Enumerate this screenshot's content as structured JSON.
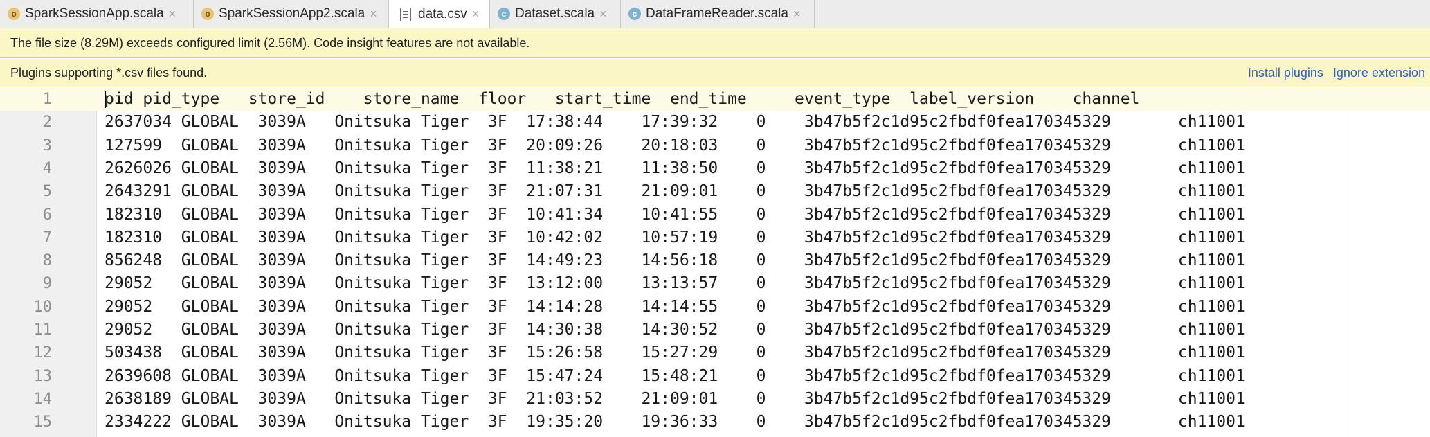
{
  "tabs": [
    {
      "label": "SparkSessionApp.scala",
      "icon": "scala-object-icon",
      "icon_glyph": "o",
      "close": "×"
    },
    {
      "label": "SparkSessionApp2.scala",
      "icon": "scala-object-icon",
      "icon_glyph": "o",
      "close": "×"
    },
    {
      "label": "data.csv",
      "icon": "csv-file-icon",
      "icon_glyph": "",
      "close": "×",
      "active": true
    },
    {
      "label": "Dataset.scala",
      "icon": "scala-class-icon",
      "icon_glyph": "c",
      "close": "×"
    },
    {
      "label": "DataFrameReader.scala",
      "icon": "scala-class-icon",
      "icon_glyph": "c",
      "close": "×"
    }
  ],
  "banners": {
    "size_warning": "The file size (8.29M) exceeds configured limit (2.56M). Code insight features are not available.",
    "plugins_text": "Plugins supporting *.csv files found.",
    "install_plugins": "Install plugins",
    "ignore_extension": "Ignore extension"
  },
  "editor": {
    "lines": [
      {
        "num": "1",
        "text": "pid pid_type   store_id    store_name  floor   start_time  end_time     event_type  label_version    channel"
      },
      {
        "num": "2",
        "text": "2637034 GLOBAL  3039A   Onitsuka Tiger  3F  17:38:44    17:39:32    0    3b47b5f2c1d95c2fbdf0fea170345329       ch11001"
      },
      {
        "num": "3",
        "text": "127599  GLOBAL  3039A   Onitsuka Tiger  3F  20:09:26    20:18:03    0    3b47b5f2c1d95c2fbdf0fea170345329       ch11001"
      },
      {
        "num": "4",
        "text": "2626026 GLOBAL  3039A   Onitsuka Tiger  3F  11:38:21    11:38:50    0    3b47b5f2c1d95c2fbdf0fea170345329       ch11001"
      },
      {
        "num": "5",
        "text": "2643291 GLOBAL  3039A   Onitsuka Tiger  3F  21:07:31    21:09:01    0    3b47b5f2c1d95c2fbdf0fea170345329       ch11001"
      },
      {
        "num": "6",
        "text": "182310  GLOBAL  3039A   Onitsuka Tiger  3F  10:41:34    10:41:55    0    3b47b5f2c1d95c2fbdf0fea170345329       ch11001"
      },
      {
        "num": "7",
        "text": "182310  GLOBAL  3039A   Onitsuka Tiger  3F  10:42:02    10:57:19    0    3b47b5f2c1d95c2fbdf0fea170345329       ch11001"
      },
      {
        "num": "8",
        "text": "856248  GLOBAL  3039A   Onitsuka Tiger  3F  14:49:23    14:56:18    0    3b47b5f2c1d95c2fbdf0fea170345329       ch11001"
      },
      {
        "num": "9",
        "text": "29052   GLOBAL  3039A   Onitsuka Tiger  3F  13:12:00    13:13:57    0    3b47b5f2c1d95c2fbdf0fea170345329       ch11001"
      },
      {
        "num": "10",
        "text": "29052   GLOBAL  3039A   Onitsuka Tiger  3F  14:14:28    14:14:55    0    3b47b5f2c1d95c2fbdf0fea170345329       ch11001"
      },
      {
        "num": "11",
        "text": "29052   GLOBAL  3039A   Onitsuka Tiger  3F  14:30:38    14:30:52    0    3b47b5f2c1d95c2fbdf0fea170345329       ch11001"
      },
      {
        "num": "12",
        "text": "503438  GLOBAL  3039A   Onitsuka Tiger  3F  15:26:58    15:27:29    0    3b47b5f2c1d95c2fbdf0fea170345329       ch11001"
      },
      {
        "num": "13",
        "text": "2639608 GLOBAL  3039A   Onitsuka Tiger  3F  15:47:24    15:48:21    0    3b47b5f2c1d95c2fbdf0fea170345329       ch11001"
      },
      {
        "num": "14",
        "text": "2638189 GLOBAL  3039A   Onitsuka Tiger  3F  21:03:52    21:09:01    0    3b47b5f2c1d95c2fbdf0fea170345329       ch11001"
      },
      {
        "num": "15",
        "text": "2334222 GLOBAL  3039A   Onitsuka Tiger  3F  19:35:20    19:36:33    0    3b47b5f2c1d95c2fbdf0fea170345329       ch11001"
      }
    ]
  },
  "colors": {
    "banner_bg": "#fbf6c6",
    "link": "#2f5fc6",
    "current_line": "#fdfbe6"
  }
}
